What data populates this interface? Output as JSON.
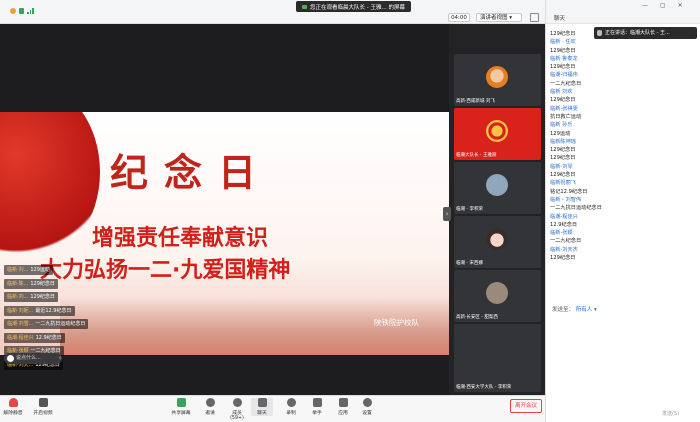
{
  "topbar": {
    "speaking_pill": "您正在观看临晨大队长 - 王雅... 的屏幕",
    "time": "04:00",
    "view_btn": "演讲者视图"
  },
  "slide": {
    "title": "纪念日",
    "line1": "增强责任奉献意识",
    "line2": "大力弘扬一二·九爱国精神",
    "org": "陕铁院护校队"
  },
  "overlay_msgs": [
    {
      "u": "临新·刘...",
      "t": "129运动"
    },
    {
      "u": "临新·陈...",
      "t": "129纪念日"
    },
    {
      "u": "临新·刘...",
      "t": "129纪念日"
    },
    {
      "u": "临新·刘妮...",
      "t": "最近12.9纪念日"
    },
    {
      "u": "临潮·刘雪...",
      "t": "一二九抗日运动纪念日"
    },
    {
      "u": "临潮·程佳兴",
      "t": "12.9纪念日"
    },
    {
      "u": "临新·张颖",
      "t": "一二九纪念日"
    },
    {
      "u": "临新·刘天...",
      "t": "129纪念日"
    }
  ],
  "chat_pill": "说点什么...",
  "videos": [
    {
      "name": "高新·西咸新城·刘飞"
    },
    {
      "name": "临潮大队长 - 王雅丽"
    },
    {
      "name": "临潮 - 李积荣"
    },
    {
      "name": "临潮 - 宋西娜"
    },
    {
      "name": "高新·长安区 - 甜梨西"
    },
    {
      "name": "临潮·西安大学大队 - 李积荣"
    }
  ],
  "toolbar": {
    "mute": "解除静音",
    "video": "开启视频",
    "share": "共享屏幕",
    "invite": "邀请",
    "members": "成员(59+)",
    "chat": "聊天",
    "record": "录制",
    "hands": "举手",
    "apps": "应用",
    "settings": "设置",
    "end": "离开会议"
  },
  "chat_panel": {
    "title": "聊天",
    "speaking": "正在讲话：临潮大队长 - 王...",
    "lines": [
      {
        "u": false,
        "t": "129纪念日"
      },
      {
        "u": true,
        "t": "临新 · 任欢"
      },
      {
        "u": false,
        "t": "129纪念日"
      },
      {
        "u": true,
        "t": "临新·鲁泰龙"
      },
      {
        "u": false,
        "t": "129纪念日"
      },
      {
        "u": true,
        "t": "临潮-归福伟"
      },
      {
        "u": false,
        "t": "一二九纪念日"
      },
      {
        "u": true,
        "t": "临新 刘欢"
      },
      {
        "u": false,
        "t": "129纪念日"
      },
      {
        "u": true,
        "t": "临新-张祺雯"
      },
      {
        "u": false,
        "t": "抗日救亡运动"
      },
      {
        "u": true,
        "t": "临新 孙乐"
      },
      {
        "u": false,
        "t": "129运动"
      },
      {
        "u": true,
        "t": "临新陈坤瑶"
      },
      {
        "u": false,
        "t": "129纪念日"
      },
      {
        "u": false,
        "t": "129纪念日"
      },
      {
        "u": true,
        "t": "临新-刘琴"
      },
      {
        "u": false,
        "t": "129纪念日"
      },
      {
        "u": true,
        "t": "临新祝丽飞"
      },
      {
        "u": false,
        "t": "铭记12.9纪念日"
      },
      {
        "u": true,
        "t": "临新 - 刘智伟"
      },
      {
        "u": false,
        "t": "一二九抗日运动纪念日"
      },
      {
        "u": true,
        "t": "临潮-程佳兴"
      },
      {
        "u": false,
        "t": "12.9纪念日"
      },
      {
        "u": true,
        "t": "临新-张颖"
      },
      {
        "u": false,
        "t": "一二九纪念日"
      },
      {
        "u": true,
        "t": "临新-刘天杰"
      },
      {
        "u": false,
        "t": "129纪念日"
      }
    ],
    "send_to_label": "发送至：",
    "send_to_value": "所有人 ▾",
    "send_btn": "发送(S)"
  },
  "colors": {
    "accent": "#2b6fd6",
    "slide_red": "#d0201a",
    "end_red": "#e54545"
  }
}
